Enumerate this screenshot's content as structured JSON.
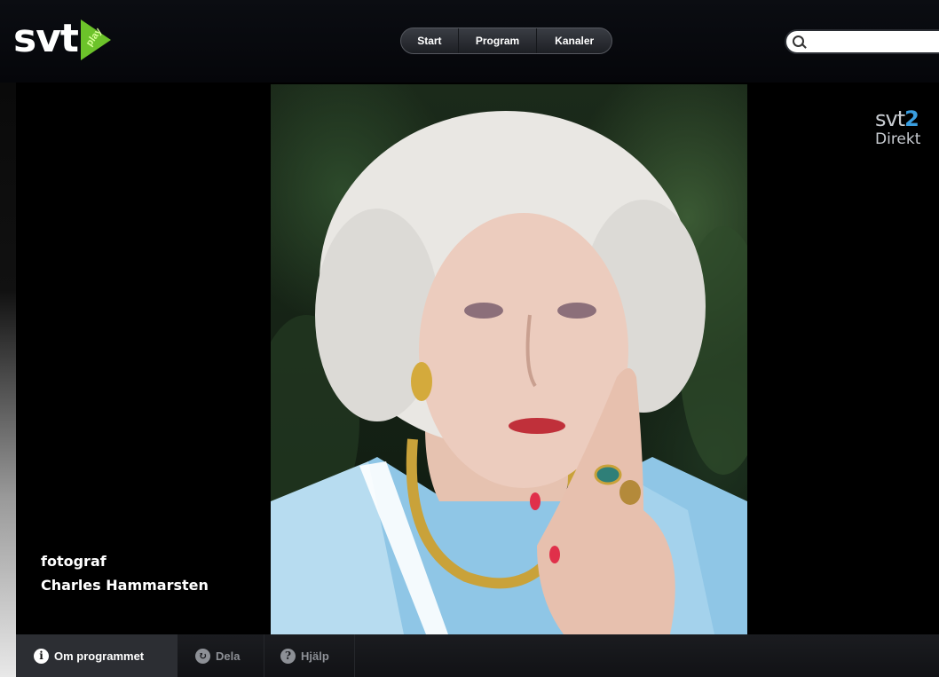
{
  "header": {
    "logo_text": "svt",
    "logo_badge": "play",
    "nav": [
      {
        "label": "Start"
      },
      {
        "label": "Program"
      },
      {
        "label": "Kanaler"
      }
    ],
    "search": {
      "placeholder": "",
      "value": ""
    }
  },
  "player": {
    "credit_line1": "fotograf",
    "credit_line2": "Charles Hammarsten",
    "channel": {
      "name": "svt",
      "number": "2",
      "sub": "Direkt"
    }
  },
  "bottom_bar": {
    "tabs": [
      {
        "label": "Om programmet",
        "icon": "i"
      },
      {
        "label": "Dela",
        "icon": "↻"
      },
      {
        "label": "Hjälp",
        "icon": "?"
      }
    ]
  }
}
